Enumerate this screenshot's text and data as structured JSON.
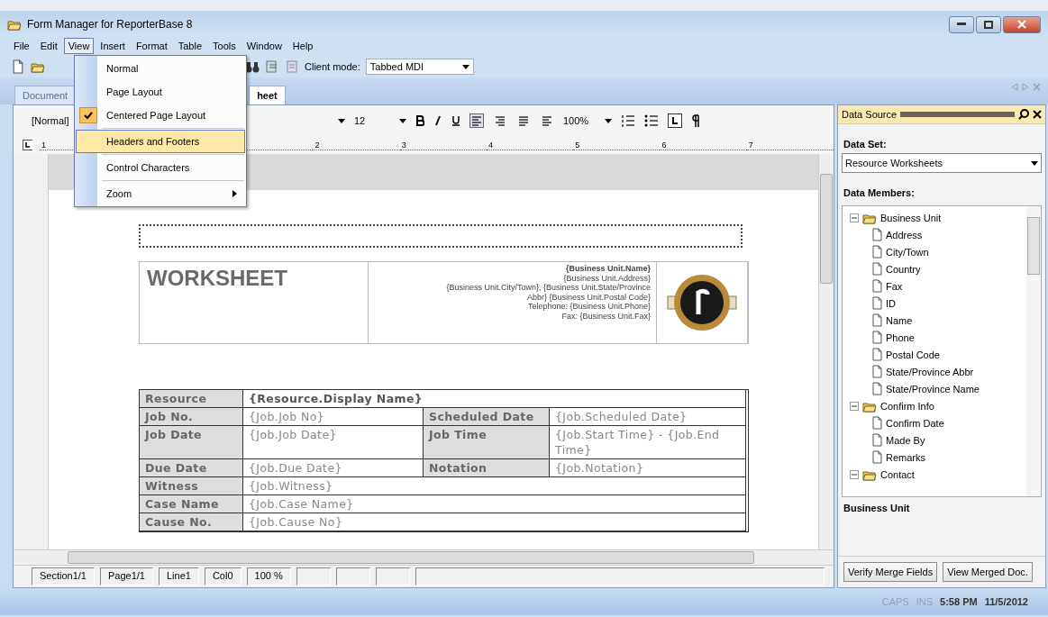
{
  "window": {
    "title": "Form Manager for ReporterBase 8"
  },
  "menu_bar": [
    {
      "label": "File",
      "selected": false
    },
    {
      "label": "Edit",
      "selected": false
    },
    {
      "label": "View",
      "selected": true
    },
    {
      "label": "Insert",
      "selected": false
    },
    {
      "label": "Format",
      "selected": false
    },
    {
      "label": "Table",
      "selected": false
    },
    {
      "label": "Tools",
      "selected": false
    },
    {
      "label": "Window",
      "selected": false
    },
    {
      "label": "Help",
      "selected": false
    }
  ],
  "view_menu": [
    {
      "kind": "item",
      "label": "Normal",
      "checked": false,
      "highlighted": false
    },
    {
      "kind": "item",
      "label": "Page Layout",
      "checked": false,
      "highlighted": false
    },
    {
      "kind": "item",
      "label": "Centered Page Layout",
      "checked": true,
      "highlighted": false
    },
    {
      "kind": "item",
      "label": "Headers and Footers",
      "checked": false,
      "highlighted": true
    },
    {
      "kind": "item",
      "label": "Control Characters",
      "checked": false,
      "highlighted": false
    },
    {
      "kind": "submenu",
      "label": "Zoom",
      "checked": false,
      "highlighted": false
    }
  ],
  "toolbar": {
    "client_mode_label": "Client mode:",
    "client_mode": "Tabbed MDI"
  },
  "document_tabs": [
    {
      "label": "Document",
      "selected": false
    },
    {
      "label": "heet",
      "selected": true
    }
  ],
  "format_toolbar": {
    "style": "[Normal]",
    "font_size": "12",
    "zoom": "100%"
  },
  "ruler": [
    "1",
    "2",
    "3",
    "4",
    "5",
    "6",
    "7"
  ],
  "document": {
    "title": "WORKSHEET",
    "address_lines": [
      {
        "text": "{Business Unit.Name}",
        "bold": true
      },
      {
        "text": "{Business Unit.Address}",
        "bold": false
      },
      {
        "text": "{Business Unit.City/Town}, {Business Unit.State/Province",
        "bold": false
      },
      {
        "text": "Abbr}  {Business Unit.Postal Code}",
        "bold": false
      },
      {
        "text": "Telephone: {Business Unit.Phone}",
        "bold": false
      },
      {
        "text": "Fax: {Business Unit.Fax}",
        "bold": false
      }
    ],
    "rows": [
      [
        {
          "kind": "label",
          "text": "Resource"
        },
        {
          "kind": "strong",
          "text": "{Resource.Display Name}"
        }
      ],
      [
        {
          "kind": "label",
          "text": "Job No."
        },
        {
          "kind": "value",
          "text": "{Job.Job No}"
        },
        {
          "kind": "label",
          "text": "Scheduled Date"
        },
        {
          "kind": "value",
          "text": "{Job.Scheduled Date}"
        }
      ],
      [
        {
          "kind": "label",
          "text": "Job Date"
        },
        {
          "kind": "value",
          "text": "{Job.Job Date}"
        },
        {
          "kind": "label",
          "text": "Job Time"
        },
        {
          "kind": "value",
          "text": "{Job.Start Time} - {Job.End Time}"
        }
      ],
      [
        {
          "kind": "label",
          "text": "Due Date"
        },
        {
          "kind": "value",
          "text": "{Job.Due Date}"
        },
        {
          "kind": "label",
          "text": "Notation"
        },
        {
          "kind": "value",
          "text": "{Job.Notation}"
        }
      ],
      [
        {
          "kind": "label",
          "text": "Witness"
        },
        {
          "kind": "value",
          "text": "{Job.Witness}"
        }
      ],
      [
        {
          "kind": "label",
          "text": "Case Name"
        },
        {
          "kind": "value",
          "text": "{Job.Case Name}"
        }
      ],
      [
        {
          "kind": "label",
          "text": "Cause No."
        },
        {
          "kind": "value",
          "text": "{Job.Cause No}"
        }
      ]
    ]
  },
  "status_bar": [
    "Section1/1",
    "Page1/1",
    "Line1",
    "Col0",
    "100 %"
  ],
  "data_source": {
    "title": "Data Source",
    "data_set_label": "Data Set:",
    "data_set": "Resource Worksheets",
    "data_members_label": "Data Members:",
    "tree": [
      {
        "label": "Business Unit",
        "expanded": true,
        "children": [
          {
            "label": "Address"
          },
          {
            "label": "City/Town"
          },
          {
            "label": "Country"
          },
          {
            "label": "Fax"
          },
          {
            "label": "ID"
          },
          {
            "label": "Name"
          },
          {
            "label": "Phone"
          },
          {
            "label": "Postal Code"
          },
          {
            "label": "State/Province Abbr"
          },
          {
            "label": "State/Province Name"
          }
        ]
      },
      {
        "label": "Confirm Info",
        "expanded": true,
        "children": [
          {
            "label": "Confirm Date"
          },
          {
            "label": "Made By"
          },
          {
            "label": "Remarks"
          }
        ]
      },
      {
        "label": "Contact",
        "expanded": true
      }
    ],
    "selected_member": "Business Unit",
    "buttons": [
      "Verify Merge Fields",
      "View Merged Doc."
    ]
  },
  "indicators": [
    {
      "label": "CAPS",
      "active": false
    },
    {
      "label": "INS",
      "active": false
    }
  ],
  "time": "5:58 PM",
  "date": "11/5/2012"
}
